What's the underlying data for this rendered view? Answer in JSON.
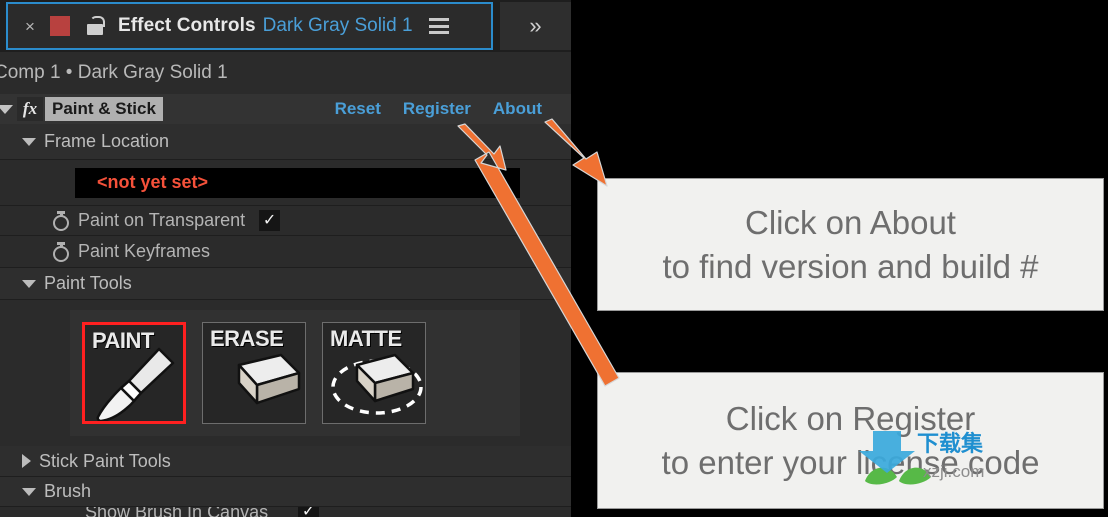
{
  "panel": {
    "tab": {
      "close_icon": "close-icon",
      "color_swatch": "#b8413f",
      "lock_icon": "unlocked-padlock-icon",
      "title": "Effect Controls",
      "subject": "Dark Gray Solid 1",
      "menu_icon": "hamburger-menu-icon",
      "overflow_label": "»"
    },
    "breadcrumb": "Comp 1 • Dark Gray Solid 1",
    "effect": {
      "disclosure_icon": "triangle-down-icon",
      "fx_icon": "fx",
      "name": "Paint & Stick",
      "links": [
        {
          "label": "Reset",
          "name": "reset-link"
        },
        {
          "label": "Register",
          "name": "register-link"
        },
        {
          "label": "About",
          "name": "about-link"
        }
      ]
    },
    "groups": {
      "frame_location": "Frame Location",
      "paint_tools": "Paint Tools",
      "stick_paint_tools": "Stick Paint Tools",
      "brush": "Brush"
    },
    "frame_location_value": "<not yet set>",
    "properties": [
      {
        "label": "Paint on Transparent",
        "checked": true,
        "check_glyph": "✓"
      },
      {
        "label": "Paint Keyframes",
        "checked": false,
        "check_glyph": ""
      }
    ],
    "tools": [
      {
        "caption": "PAINT",
        "icon": "paint-brush-icon",
        "selected": true
      },
      {
        "caption": "ERASE",
        "icon": "eraser-icon",
        "selected": false
      },
      {
        "caption": "MATTE",
        "icon": "matte-eraser-icon",
        "selected": false
      }
    ],
    "cut_off_row": {
      "label": "Show Brush In Canvas",
      "check_glyph": "✓"
    }
  },
  "callouts": [
    {
      "line1": "Click on About",
      "line2": "to find version and build #"
    },
    {
      "line1": "Click on Register",
      "line2": "to enter your license code"
    }
  ],
  "watermark": {
    "cn_text": "下载集",
    "url_text": "xzji.com",
    "arrow_icon": "download-arrow-icon",
    "blue": "#39a9dc",
    "green": "#57b947",
    "gray": "#8c8c8c"
  },
  "colors": {
    "accent_link": "#4a9fd8",
    "arrow_orange": "#ef7132",
    "selection_red": "#ff2020",
    "value_red": "#f5513a",
    "panel_bg": "#2b2b2b"
  },
  "annotations": {
    "arrow_about": "arrow-pointing-to-about",
    "arrow_register": "arrow-pointing-to-register"
  }
}
